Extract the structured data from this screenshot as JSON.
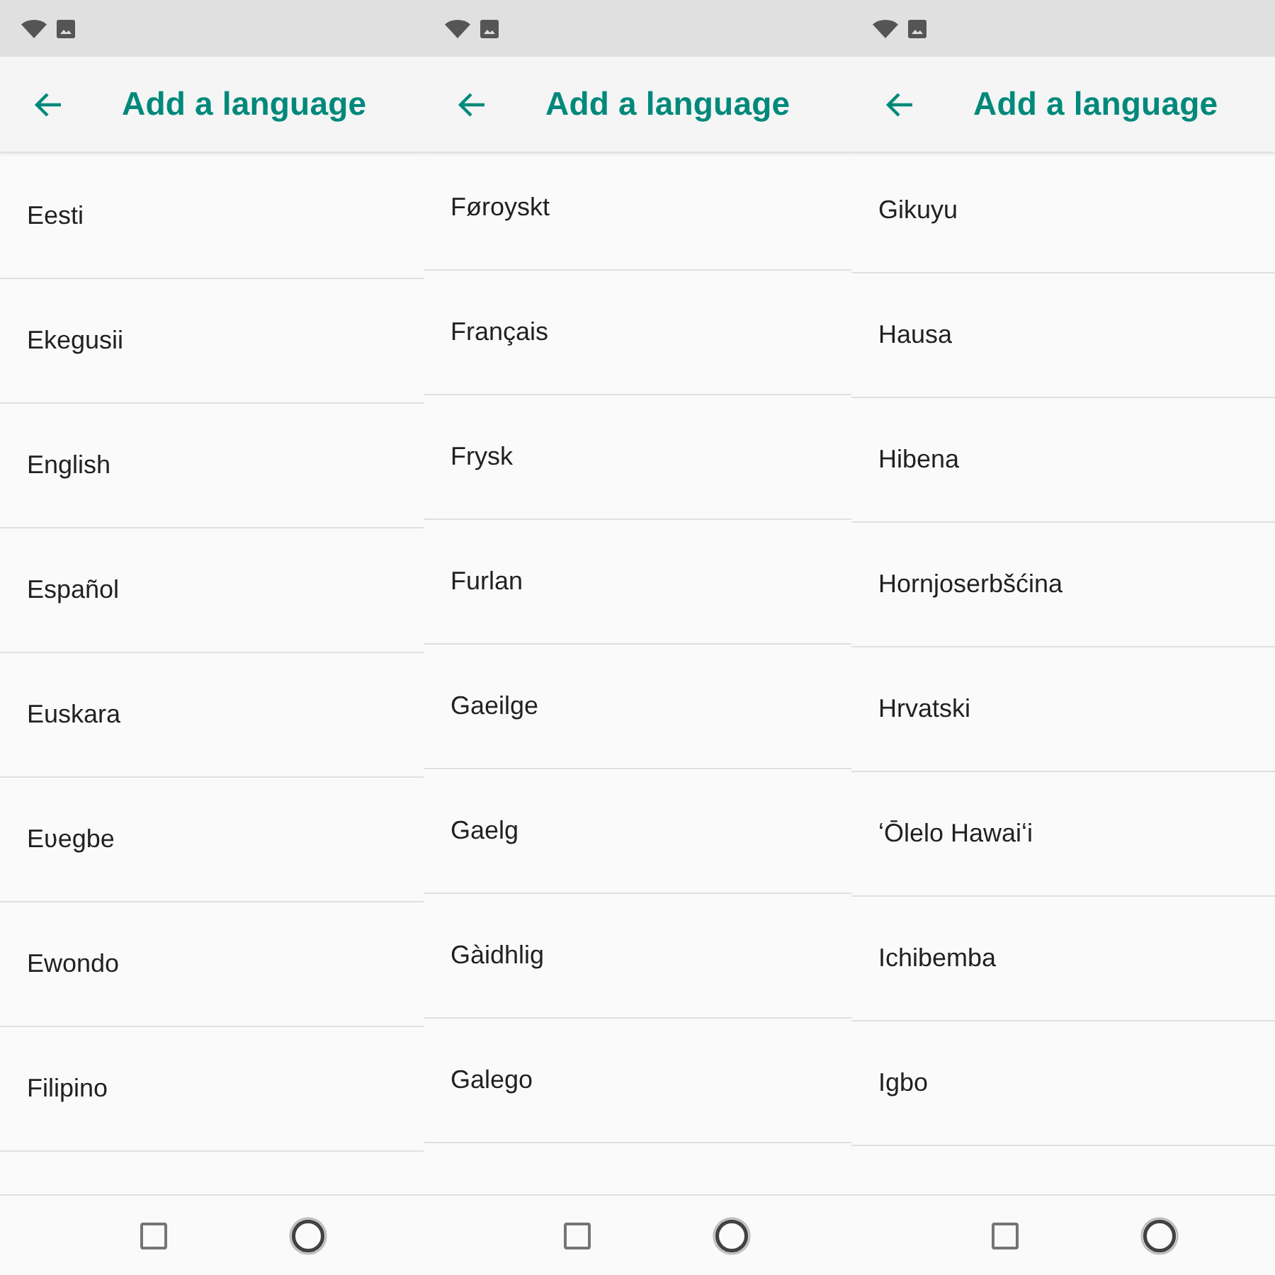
{
  "screens": [
    {
      "app_bar": {
        "title": "Add a language"
      },
      "languages": [
        "Eesti",
        "Ekegusii",
        "English",
        "Español",
        "Euskara",
        "Eʋegbe",
        "Ewondo",
        "Filipino"
      ]
    },
    {
      "app_bar": {
        "title": "Add a language"
      },
      "languages": [
        "Føroyskt",
        "Français",
        "Frysk",
        "Furlan",
        "Gaeilge",
        "Gaelg",
        "Gàidhlig",
        "Galego"
      ]
    },
    {
      "app_bar": {
        "title": "Add a language"
      },
      "languages": [
        "Gikuyu",
        "Hausa",
        "Hibena",
        "Hornjoserbšćina",
        "Hrvatski",
        "ʻŌlelo Hawaiʻi",
        "Ichibemba",
        "Igbo"
      ]
    }
  ]
}
